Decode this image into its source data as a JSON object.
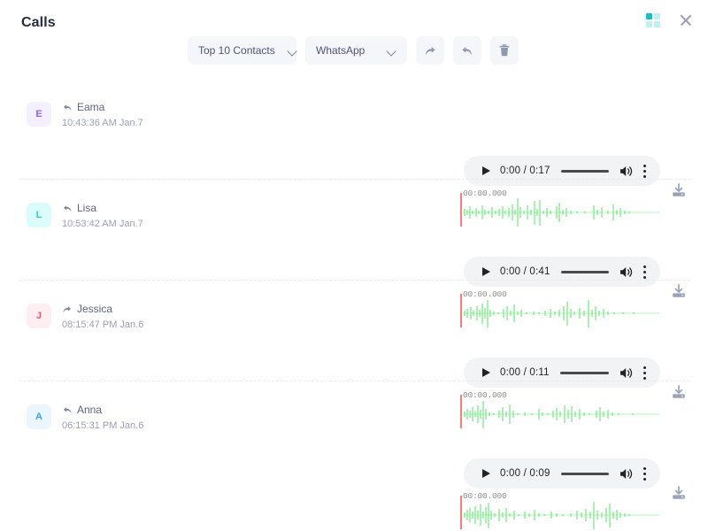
{
  "header": {
    "title": "Calls",
    "apps_icon": "apps-grid-icon",
    "close_icon": "close-icon",
    "accent_teal": "#14c0cc",
    "accent_teal_light": "#bff0f2"
  },
  "toolbar": {
    "contacts_filter": {
      "value": "Top 10 Contacts",
      "icon": "chevron-down-icon"
    },
    "source_filter": {
      "value": "WhatsApp",
      "icon": "chevron-down-icon"
    },
    "forward_label": "forward-icon",
    "reply_label": "reply-icon",
    "delete_label": "trash-icon",
    "pill_bg": "#f4f6fa"
  },
  "player_common": {
    "play_icon": "play-icon",
    "volume_icon": "volume-icon",
    "menu_icon": "more-vertical-icon",
    "download_icon": "download-icon",
    "waveform_time": "00:00.000",
    "waveform_color": "#6ef07a",
    "playhead_color": "#ff5a5a"
  },
  "calls": [
    {
      "avatar_letter": "E",
      "avatar_bg": "#f4f0ff",
      "avatar_fg": "#8b63f5",
      "direction": "incoming",
      "name": "Eama",
      "timestamp": "10:43:36 AM Jan.7",
      "current_time": "0:00",
      "duration": "0:17",
      "time_display": "0:00 / 0:17",
      "waveform_time": "00:00.000"
    },
    {
      "avatar_letter": "L",
      "avatar_bg": "#dafcfb",
      "avatar_fg": "#2fd0c8",
      "direction": "incoming",
      "name": "Lisa",
      "timestamp": "10:53:42 AM Jan.7",
      "current_time": "0:00",
      "duration": "0:41",
      "time_display": "0:00 / 0:41",
      "waveform_time": "00:00.000"
    },
    {
      "avatar_letter": "J",
      "avatar_bg": "#fdeef2",
      "avatar_fg": "#f4537c",
      "direction": "outgoing",
      "name": "Jessica",
      "timestamp": "08:15:47 PM Jan.6",
      "current_time": "0:00",
      "duration": "0:11",
      "time_display": "0:00 / 0:11",
      "waveform_time": "00:00.000"
    },
    {
      "avatar_letter": "A",
      "avatar_bg": "#eaf5fe",
      "avatar_fg": "#34a4f0",
      "direction": "incoming",
      "name": "Anna",
      "timestamp": "06:15:31 PM Jan.6",
      "current_time": "0:00",
      "duration": "0:09",
      "time_display": "0:00 / 0:09",
      "waveform_time": "00:00.000"
    }
  ]
}
